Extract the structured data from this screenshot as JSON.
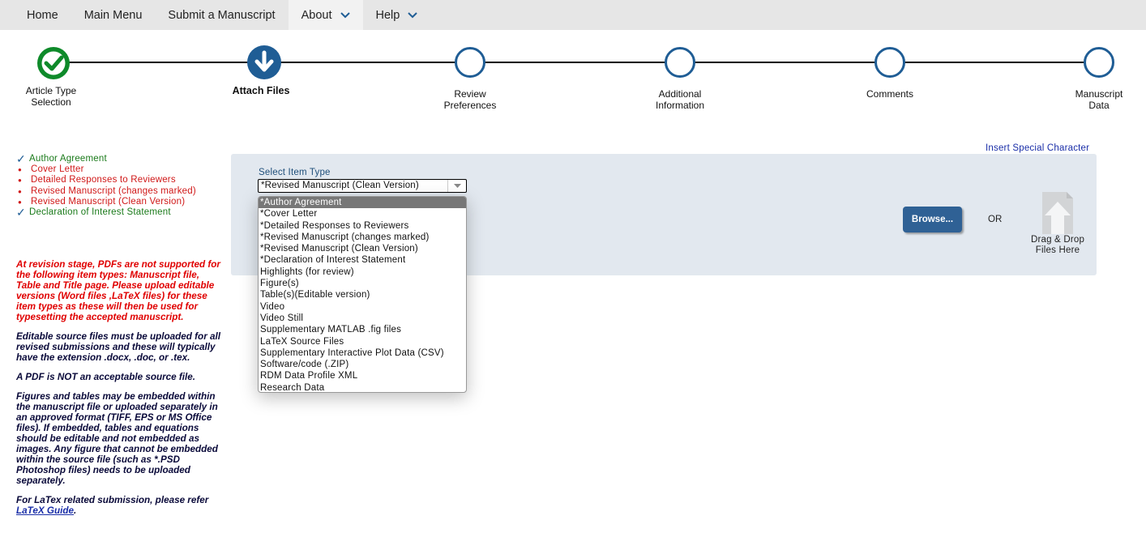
{
  "nav": {
    "items": [
      {
        "label": "Home"
      },
      {
        "label": "Main Menu"
      },
      {
        "label": "Submit a Manuscript"
      },
      {
        "label": "About"
      },
      {
        "label": "Help"
      }
    ]
  },
  "steps": [
    {
      "label_line1": "Article Type",
      "label_line2": "Selection",
      "status": "complete"
    },
    {
      "label_line1": "Attach Files",
      "label_line2": "",
      "status": "current"
    },
    {
      "label_line1": "Review",
      "label_line2": "Preferences",
      "status": "pending"
    },
    {
      "label_line1": "Additional",
      "label_line2": "Information",
      "status": "pending"
    },
    {
      "label_line1": "Comments",
      "label_line2": "",
      "status": "pending"
    },
    {
      "label_line1": "Manuscript",
      "label_line2": "Data",
      "status": "pending"
    }
  ],
  "checklist": [
    {
      "label": "Author Agreement",
      "done": true
    },
    {
      "label": "Cover Letter",
      "done": false
    },
    {
      "label": "Detailed Responses to Reviewers",
      "done": false
    },
    {
      "label": "Revised Manuscript (changes marked)",
      "done": false
    },
    {
      "label": "Revised Manuscript (Clean Version)",
      "done": false
    },
    {
      "label": "Declaration of Interest Statement",
      "done": true
    }
  ],
  "notes": {
    "red_note": "At revision stage, PDFs are not supported for the following item types: Manuscript file, Table and Title page. Please upload editable versions (Word files ,LaTeX files) for these item types as these will then be used for typesetting the accepted manuscript.",
    "editable_note": "Editable source files must be uploaded for all revised submissions and these will typically have the extension .docx, .doc, or .tex.",
    "pdf_note": "A PDF is NOT an acceptable source file.",
    "figures_note": "Figures and tables may be embedded within the manuscript file or uploaded separately in an approved format (TIFF, EPS or MS Office files). If embedded, tables and equations should be editable and not embedded as images. Any figure that cannot be embedded within the source file (such as *.PSD Photoshop files) needs to be uploaded separately.",
    "latex_prefix": "For LaTex related submission, please refer ",
    "latex_link": "LaTeX Guide",
    "latex_suffix": "."
  },
  "upload": {
    "insert_special": "Insert Special Character",
    "select_label": "Select Item Type",
    "selected_value": "*Revised Manuscript (Clean Version)",
    "options": [
      "*Author Agreement",
      "*Cover Letter",
      "*Detailed Responses to Reviewers",
      "*Revised Manuscript (changes marked)",
      "*Revised Manuscript (Clean Version)",
      "*Declaration of Interest Statement",
      "Highlights (for review)",
      "Figure(s)",
      "Table(s)(Editable version)",
      "Video",
      "Video Still",
      "Supplementary MATLAB .fig files",
      "LaTeX Source Files",
      "Supplementary Interactive Plot Data (CSV)",
      "Software/code (.ZIP)",
      "RDM Data Profile XML",
      "Research Data"
    ],
    "highlighted_option": "*Author Agreement",
    "browse_label": "Browse...",
    "or_label": "OR",
    "drop_line1": "Drag & Drop",
    "drop_line2": "Files Here"
  },
  "colors": {
    "brand_blue": "#1f5d95",
    "complete_green": "#0e8a2a",
    "required_red": "#d01818",
    "panel_bg": "#e2e8ef"
  }
}
